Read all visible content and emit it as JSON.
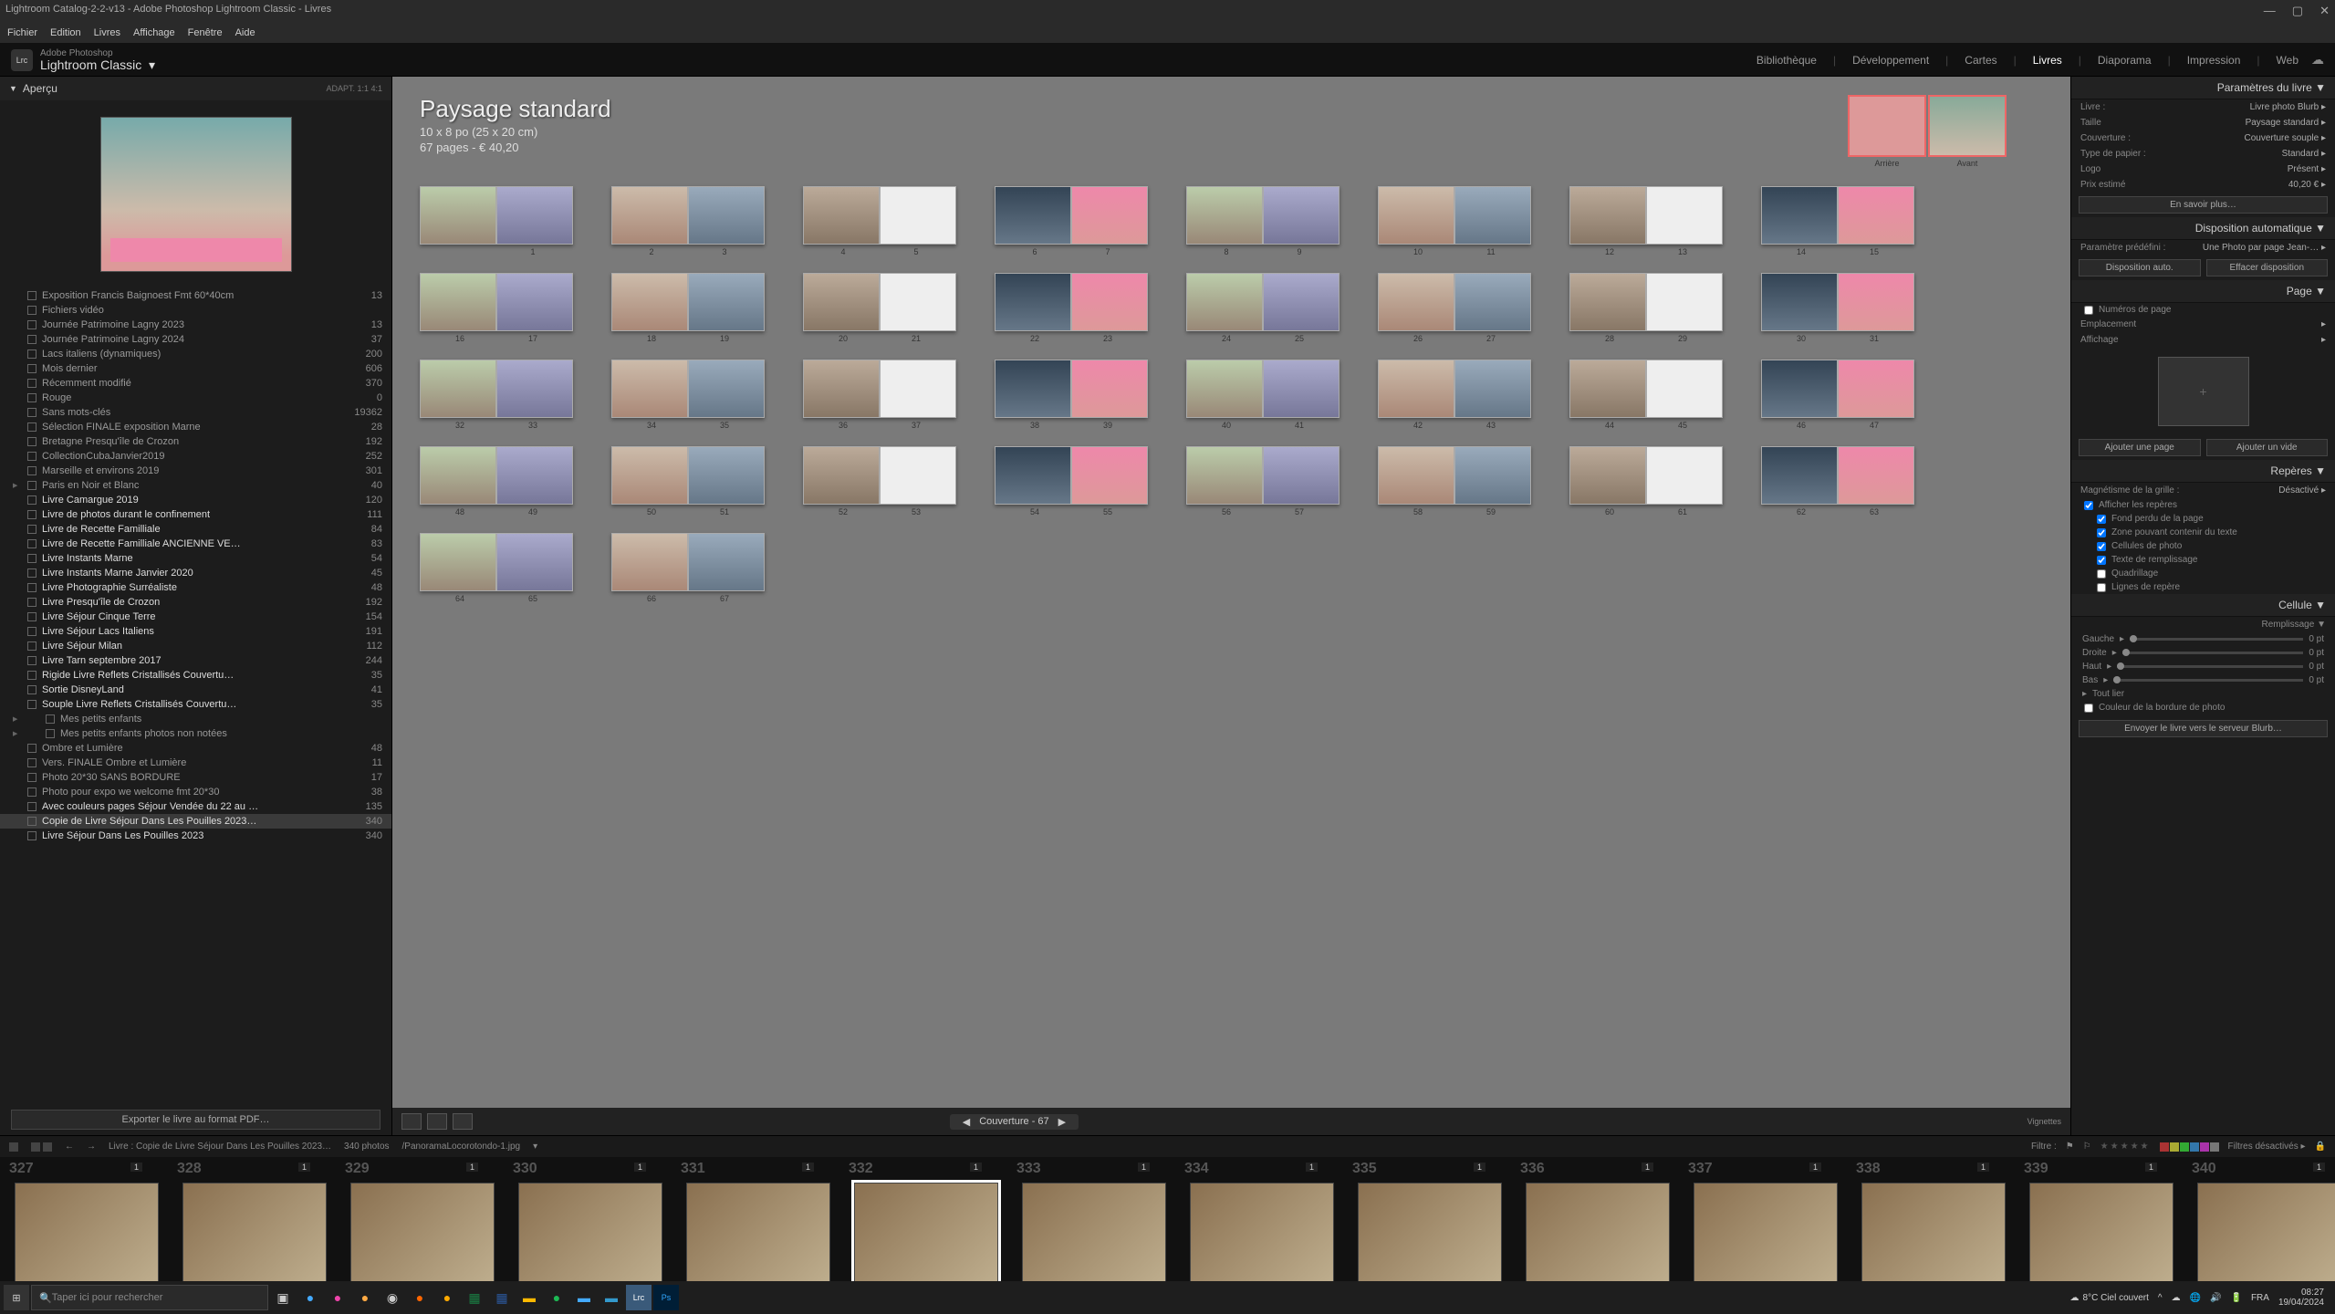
{
  "window": {
    "title": "Lightroom Catalog-2-2-v13 - Adobe Photoshop Lightroom Classic - Livres"
  },
  "menubar": [
    "Fichier",
    "Edition",
    "Livres",
    "Affichage",
    "Fenêtre",
    "Aide"
  ],
  "product": {
    "small": "Adobe Photoshop",
    "name": "Lightroom Classic",
    "badge": "Lrc"
  },
  "modules": [
    "Bibliothèque",
    "Développement",
    "Cartes",
    "Livres",
    "Diaporama",
    "Impression",
    "Web"
  ],
  "modules_active": "Livres",
  "leftpanel": {
    "preview_hdr": "Aperçu",
    "preview_rt": "ADAPT.   1:1   4:1",
    "export": "Exporter le livre au format PDF…",
    "folders": [
      {
        "n": "Exposition Francis Baignoest Fmt 60*40cm",
        "c": "13"
      },
      {
        "n": "Fichiers vidéo",
        "c": ""
      },
      {
        "n": "Journée Patrimoine Lagny 2023",
        "c": "13"
      },
      {
        "n": "Journée Patrimoine Lagny 2024",
        "c": "37"
      },
      {
        "n": "Lacs italiens (dynamiques)",
        "c": "200"
      },
      {
        "n": "Mois dernier",
        "c": "606"
      },
      {
        "n": "Récemment modifié",
        "c": "370"
      },
      {
        "n": "Rouge",
        "c": "0"
      },
      {
        "n": "Sans mots-clés",
        "c": "19362"
      },
      {
        "n": "Sélection FINALE exposition Marne",
        "c": "28"
      },
      {
        "n": "Bretagne Presqu'île de Crozon",
        "c": "192"
      },
      {
        "n": "CollectionCubaJanvier2019",
        "c": "252"
      },
      {
        "n": "Marseille et environs 2019",
        "c": "301"
      },
      {
        "n": "Paris en Noir et Blanc",
        "c": "40",
        "tri": "▶"
      },
      {
        "n": "Livre Camargue 2019",
        "c": "120",
        "b": 1
      },
      {
        "n": "Livre de photos durant le confinement",
        "c": "111",
        "b": 1
      },
      {
        "n": "Livre de Recette Familliale",
        "c": "84",
        "b": 1
      },
      {
        "n": "Livre de Recette Familliale ANCIENNE VE…",
        "c": "83",
        "b": 1
      },
      {
        "n": "Livre Instants Marne",
        "c": "54",
        "b": 1
      },
      {
        "n": "Livre Instants Marne Janvier 2020",
        "c": "45",
        "b": 1
      },
      {
        "n": "Livre Photographie Surréaliste",
        "c": "48",
        "b": 1
      },
      {
        "n": "Livre Presqu'île de Crozon",
        "c": "192",
        "b": 1
      },
      {
        "n": "Livre Séjour Cinque Terre",
        "c": "154",
        "b": 1
      },
      {
        "n": "Livre Séjour Lacs Italiens",
        "c": "191",
        "b": 1
      },
      {
        "n": "Livre Séjour Milan",
        "c": "112",
        "b": 1
      },
      {
        "n": "Livre Tarn septembre 2017",
        "c": "244",
        "b": 1
      },
      {
        "n": "Rigide Livre Reflets Cristallisés Couvertu…",
        "c": "35",
        "b": 1
      },
      {
        "n": "Sortie DisneyLand",
        "c": "41",
        "b": 1
      },
      {
        "n": "Souple Livre Reflets Cristallisés Couvertu…",
        "c": "35",
        "b": 1
      },
      {
        "n": "Mes petits enfants",
        "c": "",
        "tri": "▶",
        "indent": 1
      },
      {
        "n": "Mes petits enfants photos non notées",
        "c": "",
        "tri": "▶",
        "indent": 1
      },
      {
        "n": "Ombre et Lumière",
        "c": "48"
      },
      {
        "n": "Vers. FINALE Ombre et Lumière",
        "c": "11"
      },
      {
        "n": "Photo 20*30 SANS BORDURE",
        "c": "17"
      },
      {
        "n": "Photo pour expo we welcome fmt 20*30",
        "c": "38"
      },
      {
        "n": "Avec couleurs pages Séjour Vendée du 22 au …",
        "c": "135",
        "b": 1
      },
      {
        "n": "Copie de Livre Séjour Dans Les Pouilles 2023…",
        "c": "340",
        "b": 1,
        "sel": 1
      },
      {
        "n": "Livre Séjour Dans Les Pouilles 2023",
        "c": "340",
        "b": 1
      }
    ]
  },
  "book": {
    "title": "Paysage standard",
    "size": "10 x 8 po (25 x 20 cm)",
    "pages": "67 pages - € 40,20",
    "cover_back": "Arrière",
    "cover_front": "Avant",
    "bottom_label": "Couverture - 67",
    "vignettes": "Vignettes"
  },
  "spreads": [
    [
      "",
      "1"
    ],
    [
      "2",
      "3"
    ],
    [
      "4",
      "5"
    ],
    [
      "6",
      "7"
    ],
    [
      "8",
      "9"
    ],
    [
      "10",
      "11"
    ],
    [
      "12",
      "13"
    ],
    [
      "14",
      "15"
    ],
    [
      "16",
      "17"
    ],
    [
      "18",
      "19"
    ],
    [
      "20",
      "21"
    ],
    [
      "22",
      "23"
    ],
    [
      "24",
      "25"
    ],
    [
      "26",
      "27"
    ],
    [
      "28",
      "29"
    ],
    [
      "30",
      "31"
    ],
    [
      "32",
      "33"
    ],
    [
      "34",
      "35"
    ],
    [
      "36",
      "37"
    ],
    [
      "38",
      "39"
    ],
    [
      "40",
      "41"
    ],
    [
      "42",
      "43"
    ],
    [
      "44",
      "45"
    ],
    [
      "46",
      "47"
    ],
    [
      "48",
      "49"
    ],
    [
      "50",
      "51"
    ],
    [
      "52",
      "53"
    ],
    [
      "54",
      "55"
    ],
    [
      "56",
      "57"
    ],
    [
      "58",
      "59"
    ],
    [
      "60",
      "61"
    ],
    [
      "62",
      "63"
    ],
    [
      "64",
      "65"
    ],
    [
      "66",
      "67"
    ]
  ],
  "rightpanel": {
    "book_hdr": "Paramètres du livre",
    "rows": [
      {
        "l": "Livre :",
        "v": "Livre photo Blurb ▸"
      },
      {
        "l": "Taille",
        "v": "Paysage standard ▸"
      },
      {
        "l": "Couverture :",
        "v": "Couverture souple ▸"
      },
      {
        "l": "Type de papier :",
        "v": "Standard ▸"
      },
      {
        "l": "Logo",
        "v": "Présent ▸"
      },
      {
        "l": "Prix estimé",
        "v": "40,20 € ▸"
      }
    ],
    "learn_more": "En savoir plus…",
    "auto_hdr": "Disposition automatique",
    "preset_lbl": "Paramètre prédéfini :",
    "preset_val": "Une Photo par page Jean-… ▸",
    "auto_btn1": "Disposition auto.",
    "auto_btn2": "Effacer disposition",
    "page_hdr": "Page",
    "page_num": "Numéros de page",
    "page_loc": "Emplacement",
    "page_disp": "Affichage",
    "add_page": "Ajouter une page",
    "add_blank": "Ajouter un vide",
    "guides_hdr": "Repères",
    "grid_mag": "Magnétisme de la grille :",
    "grid_val": "Désactivé ▸",
    "show_guides": "Afficher les repères",
    "g1": "Fond perdu de la page",
    "g2": "Zone pouvant contenir du texte",
    "g3": "Cellules de photo",
    "g4": "Texte de remplissage",
    "g5": "Quadrillage",
    "g6": "Lignes de repère",
    "cell_hdr": "Cellule",
    "padding": "Remplissage",
    "s_left": "Gauche",
    "s_right": "Droite",
    "s_top": "Haut",
    "s_bottom": "Bas",
    "s_all": "Tout lier",
    "s_val": "0 pt",
    "border_color": "Couleur de la bordure de photo",
    "send_blurb": "Envoyer le livre vers le serveur Blurb…"
  },
  "filminfo": {
    "path": "Livre : Copie de Livre Séjour Dans Les Pouilles 2023…",
    "count": "340 photos",
    "file": "/PanoramaLocorotondo-1.jpg",
    "filter": "Filtre :",
    "filters_off": "Filtres désactivés ▸"
  },
  "filmstrip": {
    "start": 327,
    "items": [
      327,
      328,
      329,
      330,
      331,
      332,
      333,
      334,
      335,
      336,
      337,
      338,
      339,
      340
    ],
    "badge": "1",
    "selected": 332
  },
  "taskbar": {
    "search_ph": "Taper ici pour rechercher",
    "weather": "8°C  Ciel couvert",
    "lang": "FRA",
    "time": "08:27",
    "date": "19/04/2024"
  },
  "colors": {
    "accent": "#e8a",
    "panel": "#1c1c1c"
  }
}
